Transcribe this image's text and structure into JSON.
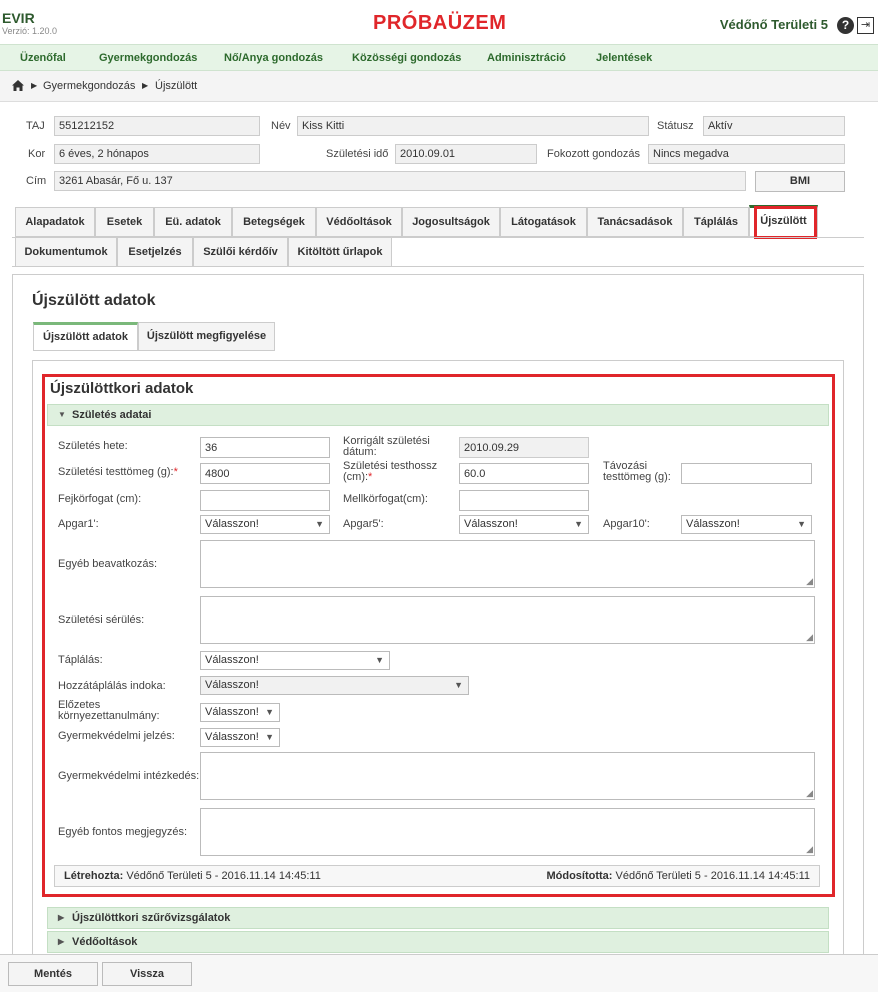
{
  "header": {
    "app_name": "EVIR",
    "version": "Verzió: 1.20.0",
    "environment": "PRÓBAÜZEM",
    "user": "Védőnő Területi 5",
    "help_glyph": "?",
    "logout_glyph": "⇥"
  },
  "menu": [
    "Üzenőfal",
    "Gyermekgondozás",
    "Nő/Anya gondozás",
    "Közösségi gondozás",
    "Adminisztráció",
    "Jelentések"
  ],
  "breadcrumb": [
    "Gyermekgondozás",
    "Újszülött"
  ],
  "patient": {
    "taj_label": "TAJ",
    "taj": "551212152",
    "nev_label": "Név",
    "nev": "Kiss Kitti",
    "statusz_label": "Státusz",
    "statusz": "Aktív",
    "kor_label": "Kor",
    "kor": "6 éves, 2 hónapos",
    "szuletesi_ido_label": "Születési idő",
    "szuletesi_ido": "2010.09.01",
    "fokozott_label": "Fokozott gondozás",
    "fokozott": "Nincs megadva",
    "cim_label": "Cím",
    "cim": "3261 Abasár, Fő u. 137",
    "bmi": "BMI"
  },
  "tabs_row1": [
    "Alapadatok",
    "Esetek",
    "Eü. adatok",
    "Betegségek",
    "Védőoltások",
    "Jogosultságok",
    "Látogatások",
    "Tanácsadások",
    "Táplálás",
    "Újszülött"
  ],
  "tabs_row2": [
    "Dokumentumok",
    "Esetjelzés",
    "Szülői kérdőív",
    "Kitöltött űrlapok"
  ],
  "panel_title": "Újszülött adatok",
  "subtabs": [
    "Újszülött adatok",
    "Újszülött megfigyelése"
  ],
  "section_title": "Újszülöttkori adatok",
  "accordions": {
    "szuletes": "Születés adatai",
    "szurovizsgalatok": "Újszülöttkori szűrővizsgálatok",
    "vedooltasok": "Védőoltások"
  },
  "form": {
    "szuletes_hete_label": "Születés hete:",
    "szuletes_hete": "36",
    "korrigalt_label_1": "Korrigált születési",
    "korrigalt_label_2": "dátum:",
    "korrigalt": "2010.09.29",
    "testtomeg_label": "Születési testtömeg (g):",
    "testtomeg": "4800",
    "testhossz_label_1": "Születési testhossz",
    "testhossz_label_2": "(cm):",
    "testhossz": "60.0",
    "tavozasi_label_1": "Távozási",
    "tavozasi_label_2": "testtömeg (g):",
    "fejkorfogat_label": "Fejkörfogat (cm):",
    "mellkorfogat_label": "Mellkörfogat(cm):",
    "apgar1_label": "Apgar1':",
    "apgar5_label": "Apgar5':",
    "apgar10_label": "Apgar10':",
    "select_placeholder": "Válasszon!",
    "egyeb_beavatkozas_label": "Egyéb beavatkozás:",
    "szuletesi_serules_label": "Születési sérülés:",
    "taplalas_label": "Táplálás:",
    "hozzataplalas_label": "Hozzátáplálás indoka:",
    "elozetes_label_1": "Előzetes",
    "elozetes_label_2": "környezettanulmány:",
    "gyermekvedelmi_jelzes_label": "Gyermekvédelmi jelzés:",
    "gyermekvedelmi_intezkedes_label": "Gyermekvédelmi intézkedés:",
    "egyeb_fontos_label": "Egyéb fontos megjegyzés:",
    "required_mark": "*"
  },
  "audit": {
    "created_label": "Létrehozta:",
    "created": " Védőnő Területi 5 - 2016.11.14 14:45:11",
    "modified_label": "Módosította:",
    "modified": " Védőnő Területi 5 - 2016.11.14 14:45:11"
  },
  "footer": {
    "save": "Mentés",
    "back": "Vissza"
  },
  "colors": {
    "accent": "#2d6a2d",
    "highlight": "#e0262a",
    "accordion": "#dff0df"
  }
}
